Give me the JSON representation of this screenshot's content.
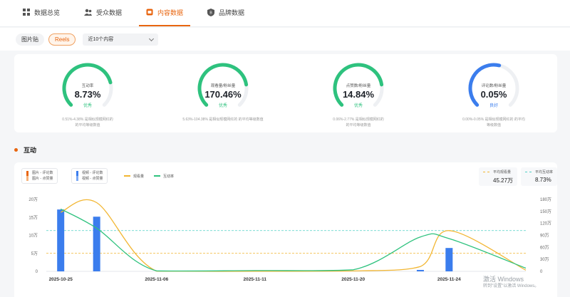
{
  "tabs": [
    {
      "label": "数据总览",
      "icon": "grid-icon",
      "active": false
    },
    {
      "label": "受众数据",
      "icon": "users-icon",
      "active": false
    },
    {
      "label": "内容数据",
      "icon": "content-icon",
      "active": true
    },
    {
      "label": "品牌数据",
      "icon": "brand-shield-icon",
      "active": false
    }
  ],
  "filters": {
    "pills": [
      "图片贴",
      "Reels"
    ],
    "active_pill": "Reels",
    "select_value": "近10个内容"
  },
  "gauges": [
    {
      "label": "互动率",
      "value": "8.73%",
      "status": "优秀",
      "fraction": 0.78,
      "color": "#2ec27e",
      "desc_line1": "0.51%-4.38% 是相似规模网红的",
      "desc_line2": "的平均等级数值"
    },
    {
      "label": "观看量/粉丝量",
      "value": "170.46%",
      "status": "优秀",
      "fraction": 0.8,
      "color": "#2ec27e",
      "desc_line1": "5.63%-104.38% 是相似规模网红的 的平均等级数值",
      "desc_line2": ""
    },
    {
      "label": "点赞数/粉丝量",
      "value": "14.84%",
      "status": "优秀",
      "fraction": 0.8,
      "color": "#2ec27e",
      "desc_line1": "0.06%-2.77% 是相似规模网红的",
      "desc_line2": "的平均等级数值"
    },
    {
      "label": "评论数/粉丝量",
      "value": "0.05%",
      "status": "良好",
      "fraction": 0.55,
      "color": "#3b7ded",
      "desc_line1": "0.00%-0.05% 是相似规模网红的 的平均",
      "desc_line2": "等级数值"
    }
  ],
  "section_title": "互动",
  "legend": {
    "image_bar_lines": [
      "图片 - 评论数",
      "图片 - 点赞量"
    ],
    "video_bar_lines": [
      "视频 - 评论数",
      "视频 - 点赞量"
    ],
    "views_label": "观看量",
    "engagement_label": "互动率",
    "avg_views_label": "平均观看量",
    "avg_views_value": "45.27万",
    "avg_engagement_label": "平均互动率",
    "avg_engagement_value": "8.73%"
  },
  "colors": {
    "accent": "#e8650f",
    "bar_blue": "#3b7ded",
    "views_line": "#f2b632",
    "engagement_line": "#2ec27e",
    "image_bar_top": "#e8650f",
    "image_bar_bottom": "#f6b27a"
  },
  "chart_data": {
    "type": "line",
    "x": [
      "2025-10-25",
      "2025-10-28",
      "2025-11-06",
      "2025-11-11",
      "2025-11-20",
      "2025-11-22",
      "2025-11-24",
      "2025-11-27"
    ],
    "x_tick_labels": [
      "2025-10-25",
      "2025-11-06",
      "2025-11-11",
      "2025-11-20",
      "2025-11-24"
    ],
    "y_left_ticks": [
      "0",
      "5万",
      "10万",
      "15万",
      "20万"
    ],
    "y_left_range": [
      0,
      200000
    ],
    "y_right_ticks": [
      "0",
      "30万",
      "60万",
      "90万",
      "120万",
      "150万",
      "180万"
    ],
    "y_right_range": [
      0,
      1800000
    ],
    "series": [
      {
        "name": "视频 - 点赞量",
        "axis": "left",
        "kind": "bar",
        "values": [
          172000,
          152000,
          0,
          0,
          0,
          4000,
          65000,
          0
        ]
      },
      {
        "name": "观看量",
        "axis": "right",
        "kind": "line",
        "values": [
          1480000,
          1720000,
          5000,
          2000,
          10000,
          120000,
          1020000,
          30000
        ]
      },
      {
        "name": "互动率",
        "axis": "right",
        "kind": "line",
        "values": [
          1560000,
          1080000,
          12000,
          20000,
          40000,
          860000,
          820000,
          80000
        ]
      }
    ],
    "avg_views_value": 452700,
    "avg_engagement_level_right_axis": 1020000,
    "grid": true
  },
  "watermark": {
    "line1": "激活 Windows",
    "line2": "转到\"设置\"以激活 Windows。"
  }
}
